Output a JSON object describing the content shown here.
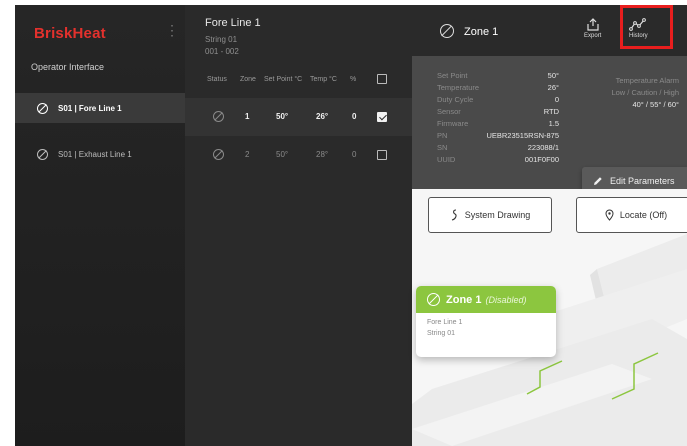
{
  "sidebar": {
    "brand": "BriskHeat",
    "section_label": "Operator Interface",
    "items": [
      {
        "label": "S01 | Fore Line 1",
        "active": true
      },
      {
        "label": "S01 | Exhaust Line 1",
        "active": false
      }
    ]
  },
  "middle": {
    "title": "Fore Line 1",
    "string": "String 01",
    "range": "001 - 002",
    "columns": {
      "status": "Status",
      "zone": "Zone",
      "setpoint": "Set Point °C",
      "temp": "Temp °C",
      "pct": "%"
    },
    "rows": [
      {
        "zone": "1",
        "setpoint": "50°",
        "temp": "26°",
        "pct": "0",
        "checked": true
      },
      {
        "zone": "2",
        "setpoint": "50°",
        "temp": "28°",
        "pct": "0",
        "checked": false
      }
    ]
  },
  "zone_header": {
    "title": "Zone 1",
    "export_label": "Export",
    "history_label": "History"
  },
  "zone_info": {
    "labels": {
      "setpoint": "Set Point",
      "temperature": "Temperature",
      "duty": "Duty Cycle",
      "sensor": "Sensor",
      "firmware": "Firmware",
      "pn": "PN",
      "sn": "SN",
      "uuid": "UUID"
    },
    "values": {
      "setpoint": "50°",
      "temperature": "26°",
      "duty": "0",
      "sensor": "RTD",
      "firmware": "1.5",
      "pn": "UEBR23515RSN-875",
      "sn": "223088/1",
      "uuid": "001F0F00"
    },
    "alarm_title": "Temperature Alarm",
    "alarm_levels": "Low / Caution / High",
    "alarm_values": "40° / 55° / 60°",
    "edit_button": "Edit Parameters"
  },
  "drawing": {
    "system_drawing_button": "System Drawing",
    "locate_button": "Locate (Off)",
    "card": {
      "title": "Zone 1",
      "status": "(Disabled)",
      "line": "Fore Line 1",
      "string": "String 01"
    }
  },
  "colors": {
    "brand": "#e3312d",
    "highlight": "#e81e1e",
    "zone_card": "#8cc63f",
    "sidebar": "#262626",
    "panel": "#2a2a2a"
  }
}
